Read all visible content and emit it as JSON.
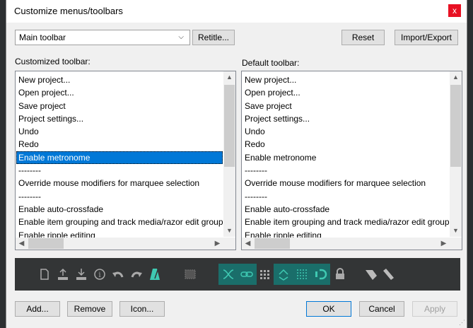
{
  "window": {
    "title": "Customize menus/toolbars",
    "close_glyph": "x"
  },
  "toolbar_select": {
    "value": "Main toolbar",
    "chevron": "⌵"
  },
  "buttons": {
    "retitle": "Retitle...",
    "reset": "Reset",
    "import_export": "Import/Export",
    "add": "Add...",
    "remove": "Remove",
    "icon": "Icon...",
    "ok": "OK",
    "cancel": "Cancel",
    "apply": "Apply"
  },
  "customized": {
    "label": "Customized toolbar:",
    "items": [
      "New project...",
      "Open project...",
      "Save project",
      "Project settings...",
      "Undo",
      "Redo",
      "Enable metronome",
      "--------",
      "Override mouse modifiers for marquee selection",
      "--------",
      "Enable auto-crossfade",
      "Enable item grouping and track media/razor edit groupi",
      "Enable ripple editing"
    ],
    "selected": "Enable metronome"
  },
  "default": {
    "label": "Default toolbar:",
    "items": [
      "New project...",
      "Open project...",
      "Save project",
      "Project settings...",
      "Undo",
      "Redo",
      "Enable metronome",
      "--------",
      "Override mouse modifiers for marquee selection",
      "--------",
      "Enable auto-crossfade",
      "Enable item grouping and track media/razor edit groupi",
      "Enable ripple editing"
    ]
  },
  "scroll_glyphs": {
    "up": "▲",
    "down": "▼",
    "left": "◀",
    "right": "▶"
  },
  "icon_strip": {
    "icons": [
      {
        "name": "new-project-icon",
        "highlighted": false
      },
      {
        "name": "open-project-icon",
        "highlighted": false
      },
      {
        "name": "save-project-icon",
        "highlighted": false
      },
      {
        "name": "project-settings-icon",
        "highlighted": false
      },
      {
        "name": "undo-icon",
        "highlighted": false
      },
      {
        "name": "redo-icon",
        "highlighted": false
      },
      {
        "name": "metronome-icon",
        "highlighted": false
      },
      {
        "name": "marquee-selection-icon",
        "highlighted": false
      },
      {
        "name": "auto-crossfade-icon",
        "highlighted": true
      },
      {
        "name": "item-grouping-icon",
        "highlighted": true
      },
      {
        "name": "ripple-editing-icon",
        "highlighted": false
      },
      {
        "name": "snap-icon",
        "highlighted": true
      },
      {
        "name": "grid-icon",
        "highlighted": true
      },
      {
        "name": "loop-icon",
        "highlighted": true
      },
      {
        "name": "lock-icon",
        "highlighted": false
      },
      {
        "name": "envelope-icon",
        "highlighted": false
      },
      {
        "name": "pencil-icon",
        "highlighted": false
      }
    ],
    "accent": "#1a6e6a",
    "background": "#333536"
  },
  "colors": {
    "selection": "#0078d7",
    "close": "#e81123"
  }
}
